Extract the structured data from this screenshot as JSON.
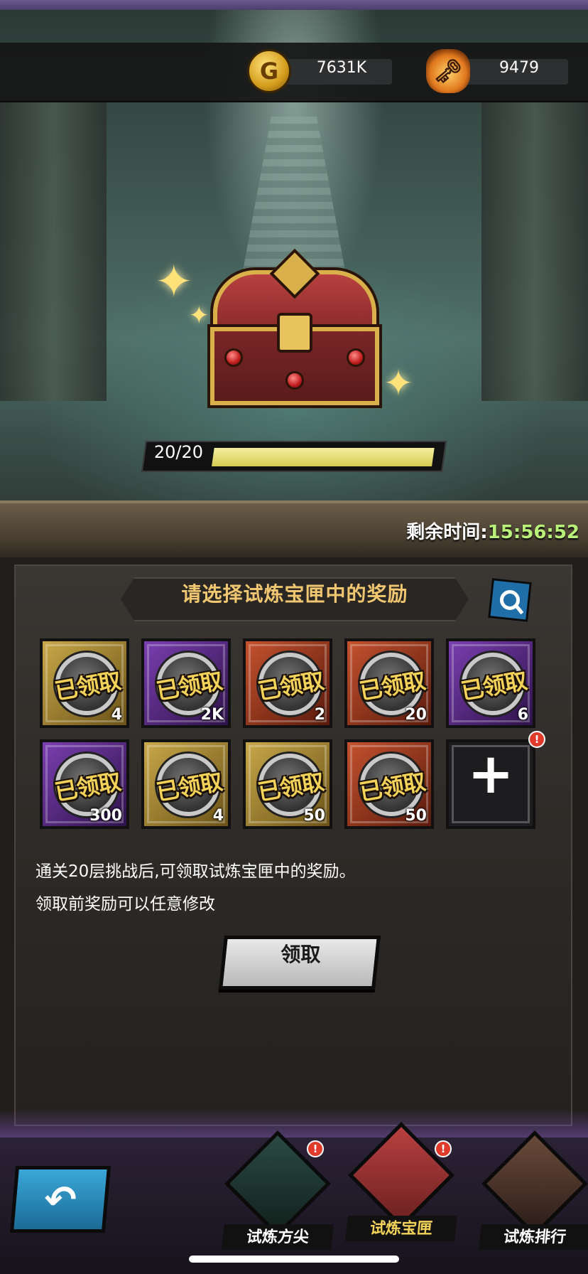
{
  "resources": {
    "gold": {
      "icon": "gold-coin-icon",
      "value": "7631K"
    },
    "token": {
      "icon": "trial-token-icon",
      "value": "9479"
    }
  },
  "chest": {
    "progress_label": "20/20",
    "progress_current": 20,
    "progress_max": 20
  },
  "timer": {
    "label": "剩余时间:",
    "value": "15:56:52"
  },
  "panel": {
    "title": "请选择试炼宝匣中的奖励",
    "claimed_stamp": "已领取",
    "rewards": [
      {
        "quality": "gold",
        "count": "4",
        "claimed": true
      },
      {
        "quality": "purple",
        "count": "2K",
        "claimed": true
      },
      {
        "quality": "red",
        "count": "2",
        "claimed": true
      },
      {
        "quality": "red",
        "count": "20",
        "claimed": true
      },
      {
        "quality": "purple",
        "count": "6",
        "claimed": true
      },
      {
        "quality": "purple",
        "count": "300",
        "claimed": true
      },
      {
        "quality": "gold",
        "count": "4",
        "claimed": true
      },
      {
        "quality": "gold",
        "count": "50",
        "claimed": true
      },
      {
        "quality": "red",
        "count": "50",
        "claimed": true
      }
    ],
    "add_slot_symbol": "+",
    "add_badge": "!",
    "description_line1": "通关20层挑战后,可领取试炼宝匣中的奖励。",
    "description_line2": "领取前奖励可以任意修改",
    "claim_button": "领取"
  },
  "bottom_nav": {
    "back_symbol": "↶",
    "tabs": [
      {
        "label": "试炼方尖",
        "badge": "!",
        "active": false
      },
      {
        "label": "试炼宝匣",
        "badge": "!",
        "active": true
      },
      {
        "label": "试炼排行",
        "badge": "",
        "active": false
      }
    ]
  },
  "colors": {
    "accent_gold_text": "#f0c770",
    "timer_green": "#b8f07a",
    "progress_fill": "#e6df7a",
    "badge_red": "#e03a2a"
  }
}
